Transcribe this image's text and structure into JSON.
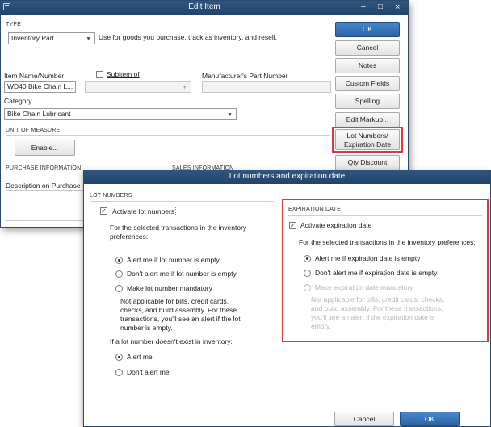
{
  "edit_item": {
    "title": "Edit Item",
    "window_controls": {
      "minimize": "–",
      "maximize": "□",
      "close": "×"
    },
    "type_section": "TYPE",
    "type_value": "Inventory Part",
    "type_description": "Use for goods you purchase, track as inventory, and resell.",
    "item_name_label": "Item Name/Number",
    "item_name_value": "WD40 Bike Chain L...",
    "subitem_label": "Subitem of",
    "manufacturer_label": "Manufacturer's Part Number",
    "category_label": "Category",
    "category_value": "Bike Chain Lubricant",
    "unit_section": "UNIT OF MEASURE",
    "enable_button": "Enable...",
    "purchase_section": "PURCHASE INFORMATION",
    "sales_section": "SALES INFORMATION",
    "description_purchase": "Description on Purchase",
    "buttons": {
      "ok": "OK",
      "cancel": "Cancel",
      "notes": "Notes",
      "custom_fields": "Custom Fields",
      "spelling": "Spelling",
      "edit_markup": "Edit Markup...",
      "lot_numbers_line1": "Lot Numbers/",
      "lot_numbers_line2": "Expiration Date",
      "qty_discount": "Qty Discount"
    }
  },
  "lot_dialog": {
    "title": "Lot numbers and expiration date",
    "lot_section": "LOT NUMBERS",
    "activate_lot": "Activate lot numbers",
    "lot_prefs_text": "For the selected transactions in the inventory preferences:",
    "lot_options": [
      {
        "label": "Alert me if lot number is empty",
        "selected": true
      },
      {
        "label": "Don't alert me if lot number is empty",
        "selected": false
      },
      {
        "label": "Make lot number mandatory",
        "selected": false
      }
    ],
    "lot_note": "Not applicable for bills, credit cards, checks, and build assembly. For these transactions, you'll see an alert if the lot number is empty.",
    "not_exist_text": "If a lot number doesn't exist in inventory:",
    "not_exist_options": [
      {
        "label": "Alert me",
        "selected": true
      },
      {
        "label": "Don't alert me",
        "selected": false
      }
    ],
    "exp_section": "EXPIRATION DATE",
    "activate_exp": "Activate expiration date",
    "exp_prefs_text": "For the selected transactions in the inventory preferences:",
    "exp_options": [
      {
        "label": "Alert me if expiration date is empty",
        "selected": true,
        "enabled": true
      },
      {
        "label": "Don't alert me if expiration date is empty",
        "selected": false,
        "enabled": true
      },
      {
        "label": "Make expiration date mandatory",
        "selected": false,
        "enabled": false
      }
    ],
    "exp_note": "Not applicable for bills, credit cards, checks, and build assembly. For these transactions, you'll see an alert if the expiration date is empty.",
    "cancel_button": "Cancel",
    "ok_button": "OK"
  },
  "colors": {
    "titlebar": "#2f5680",
    "primary_button": "#2b63a8",
    "highlight_red": "#d9383f"
  }
}
